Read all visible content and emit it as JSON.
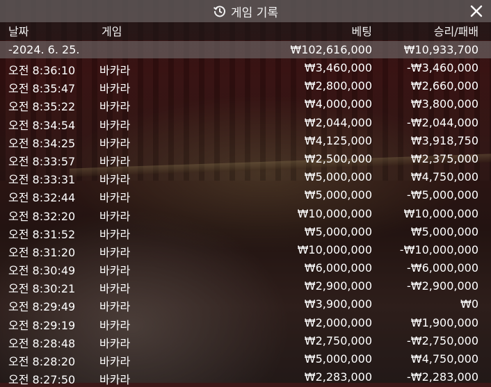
{
  "titlebar": {
    "title": "게임 기록",
    "history_icon": "history-icon",
    "close_icon": "close-icon"
  },
  "header": {
    "date": "날짜",
    "game": "게임",
    "bet": "베팅",
    "result": "승리/패배"
  },
  "summary": {
    "date": "-2024. 6. 25.",
    "bet_total": "₩102,616,000",
    "result_total": "₩10,933,700"
  },
  "rows": [
    {
      "time": "오전 8:36:10",
      "game": "바카라",
      "bet": "₩3,460,000",
      "result": "-₩3,460,000"
    },
    {
      "time": "오전 8:35:47",
      "game": "바카라",
      "bet": "₩2,800,000",
      "result": "₩2,660,000"
    },
    {
      "time": "오전 8:35:22",
      "game": "바카라",
      "bet": "₩4,000,000",
      "result": "₩3,800,000"
    },
    {
      "time": "오전 8:34:54",
      "game": "바카라",
      "bet": "₩2,044,000",
      "result": "-₩2,044,000"
    },
    {
      "time": "오전 8:34:25",
      "game": "바카라",
      "bet": "₩4,125,000",
      "result": "₩3,918,750"
    },
    {
      "time": "오전 8:33:57",
      "game": "바카라",
      "bet": "₩2,500,000",
      "result": "₩2,375,000"
    },
    {
      "time": "오전 8:33:31",
      "game": "바카라",
      "bet": "₩5,000,000",
      "result": "₩4,750,000"
    },
    {
      "time": "오전 8:32:44",
      "game": "바카라",
      "bet": "₩5,000,000",
      "result": "-₩5,000,000"
    },
    {
      "time": "오전 8:32:20",
      "game": "바카라",
      "bet": "₩10,000,000",
      "result": "₩10,000,000"
    },
    {
      "time": "오전 8:31:52",
      "game": "바카라",
      "bet": "₩5,000,000",
      "result": "₩5,000,000"
    },
    {
      "time": "오전 8:31:20",
      "game": "바카라",
      "bet": "₩10,000,000",
      "result": "-₩10,000,000"
    },
    {
      "time": "오전 8:30:49",
      "game": "바카라",
      "bet": "₩6,000,000",
      "result": "-₩6,000,000"
    },
    {
      "time": "오전 8:30:21",
      "game": "바카라",
      "bet": "₩2,900,000",
      "result": "-₩2,900,000"
    },
    {
      "time": "오전 8:29:49",
      "game": "바카라",
      "bet": "₩3,900,000",
      "result": "₩0"
    },
    {
      "time": "오전 8:29:19",
      "game": "바카라",
      "bet": "₩2,000,000",
      "result": "₩1,900,000"
    },
    {
      "time": "오전 8:28:48",
      "game": "바카라",
      "bet": "₩2,750,000",
      "result": "-₩2,750,000"
    },
    {
      "time": "오전 8:28:20",
      "game": "바카라",
      "bet": "₩5,000,000",
      "result": "₩4,750,000"
    },
    {
      "time": "오전 8:27:50",
      "game": "바카라",
      "bet": "₩2,283,000",
      "result": "-₩2,283,000"
    }
  ]
}
